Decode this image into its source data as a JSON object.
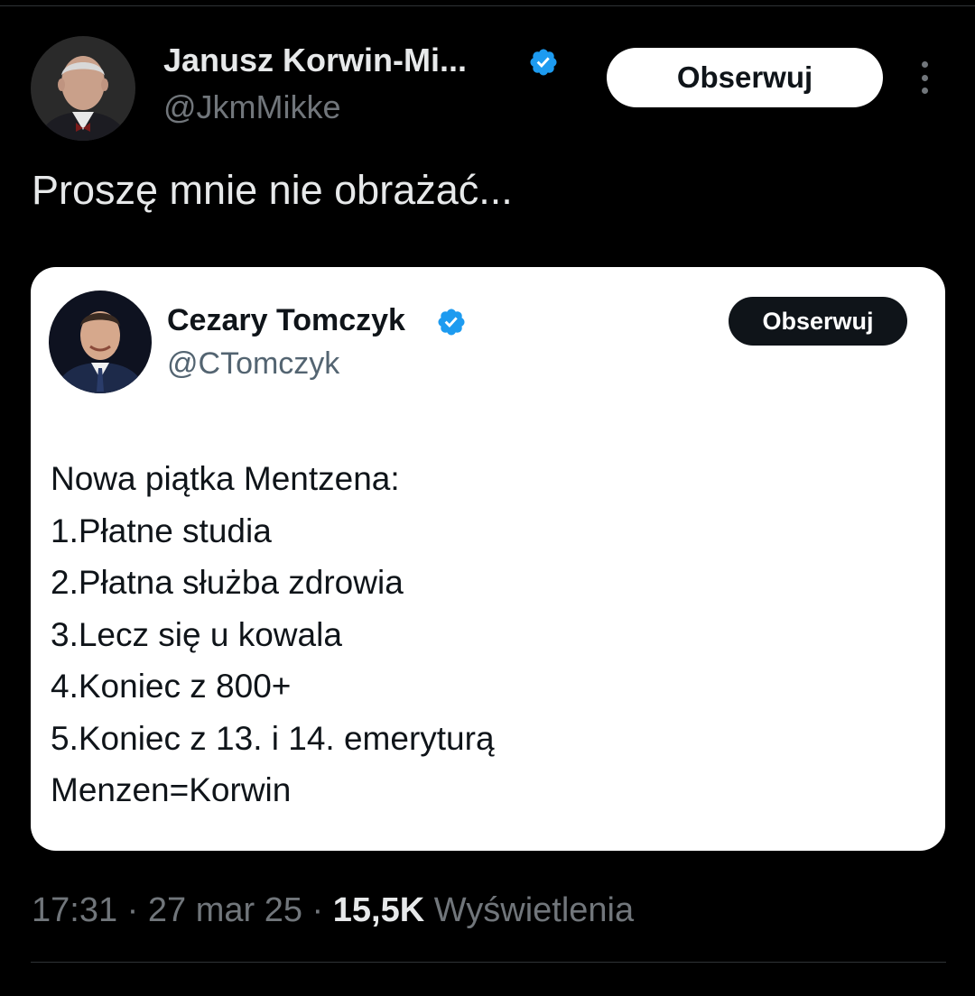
{
  "tweet": {
    "author": {
      "name": "Janusz Korwin-Mi...",
      "handle": "@JkmMikke",
      "verified": true
    },
    "follow_label": "Obserwuj",
    "text": "Proszę mnie nie obrażać...",
    "time": "17:31",
    "date": "27 mar 25",
    "separator": "·",
    "views_count": "15,5K",
    "views_label": "Wyświetlenia"
  },
  "quoted": {
    "author": {
      "name": "Cezary Tomczyk",
      "handle": "@CTomczyk",
      "verified": true
    },
    "follow_label": "Obserwuj",
    "lines": [
      "Nowa piątka Mentzena:",
      "1.Płatne studia",
      "2.Płatna służba zdrowia",
      "3.Lecz się u kowala",
      "4.Koniec z 800+",
      "5.Koniec z 13. i 14. emeryturą",
      "Menzen=Korwin"
    ]
  },
  "icons": {
    "verified": "verified-badge-icon",
    "more": "more-vertical-icon"
  },
  "colors": {
    "background": "#000000",
    "verified": "#1d9bf0",
    "muted": "#71767b",
    "text": "#e7e9ea"
  }
}
